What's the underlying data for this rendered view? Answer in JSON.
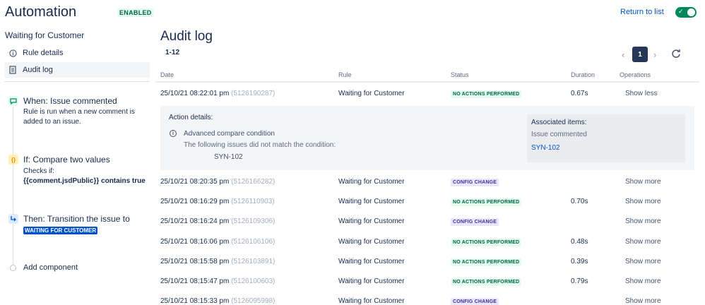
{
  "header": {
    "title": "Automation",
    "enabled_badge": "ENABLED",
    "return_link": "Return to list",
    "toggle_on": true
  },
  "sidebar": {
    "heading": "Waiting for Customer",
    "items": [
      {
        "label": "Rule details",
        "icon": "info-circle-icon",
        "active": false
      },
      {
        "label": "Audit log",
        "icon": "document-icon",
        "active": true
      }
    ],
    "components": [
      {
        "type": "trigger",
        "icon": "comment-icon",
        "icon_color": "#36b37e",
        "title": "When: Issue commented",
        "desc_line1": "Rule is run when a new comment is",
        "desc_line2": "added to an issue."
      },
      {
        "type": "condition",
        "icon": "braces-icon",
        "icon_color": "#ffab00",
        "title": "If: Compare two values",
        "desc_line1": "Checks if:",
        "desc_line2": "{{comment.jsdPublic}} contains true"
      },
      {
        "type": "action",
        "icon": "transition-icon",
        "icon_color": "#0065ff",
        "title": "Then: Transition the issue to",
        "status": "WAITING FOR CUSTOMER"
      }
    ],
    "add_component": "Add component"
  },
  "main": {
    "title": "Audit log",
    "range": "1-12",
    "pagination": {
      "current_page": "1",
      "prev_icon": "chevron-left-icon",
      "next_icon": "chevron-right-icon"
    },
    "refresh_icon": "refresh-icon",
    "columns": [
      "Date",
      "Rule",
      "Status",
      "Duration",
      "Operations"
    ],
    "rows": [
      {
        "date": "25/10/21 08:22:01 pm",
        "id": "(5126190287)",
        "rule": "Waiting for Customer",
        "status": "NO ACTIONS PERFORMED",
        "status_kind": "green",
        "duration": "0.67s",
        "op": "Show less"
      },
      {
        "date": "25/10/21 08:20:35 pm",
        "id": "(5126166282)",
        "rule": "Waiting for Customer",
        "status": "CONFIG CHANGE",
        "status_kind": "purple",
        "duration": "",
        "op": "Show more"
      },
      {
        "date": "25/10/21 08:16:29 pm",
        "id": "(5126110903)",
        "rule": "Waiting for Customer",
        "status": "NO ACTIONS PERFORMED",
        "status_kind": "green",
        "duration": "0.70s",
        "op": "Show more"
      },
      {
        "date": "25/10/21 08:16:24 pm",
        "id": "(5126109306)",
        "rule": "Waiting for Customer",
        "status": "CONFIG CHANGE",
        "status_kind": "purple",
        "duration": "",
        "op": "Show more"
      },
      {
        "date": "25/10/21 08:16:06 pm",
        "id": "(5126106106)",
        "rule": "Waiting for Customer",
        "status": "NO ACTIONS PERFORMED",
        "status_kind": "green",
        "duration": "0.48s",
        "op": "Show more"
      },
      {
        "date": "25/10/21 08:15:58 pm",
        "id": "(5126103891)",
        "rule": "Waiting for Customer",
        "status": "NO ACTIONS PERFORMED",
        "status_kind": "green",
        "duration": "0.39s",
        "op": "Show more"
      },
      {
        "date": "25/10/21 08:15:47 pm",
        "id": "(5126100603)",
        "rule": "Waiting for Customer",
        "status": "NO ACTIONS PERFORMED",
        "status_kind": "green",
        "duration": "0.79s",
        "op": "Show more"
      },
      {
        "date": "25/10/21 08:15:33 pm",
        "id": "(5126095998)",
        "rule": "Waiting for Customer",
        "status": "CONFIG CHANGE",
        "status_kind": "purple",
        "duration": "",
        "op": "Show more"
      }
    ],
    "details": {
      "heading": "Action details:",
      "condition_title": "Advanced compare condition",
      "condition_desc": "The following issues did not match the condition:",
      "condition_issue": "SYN-102",
      "assoc_title": "Associated items:",
      "assoc_sub": "Issue commented",
      "assoc_link": "SYN-102"
    }
  },
  "colors": {
    "accent": "#0052cc",
    "toggle": "#00875a",
    "green_lozenge_text": "#006644",
    "purple_lozenge_text": "#403294"
  }
}
